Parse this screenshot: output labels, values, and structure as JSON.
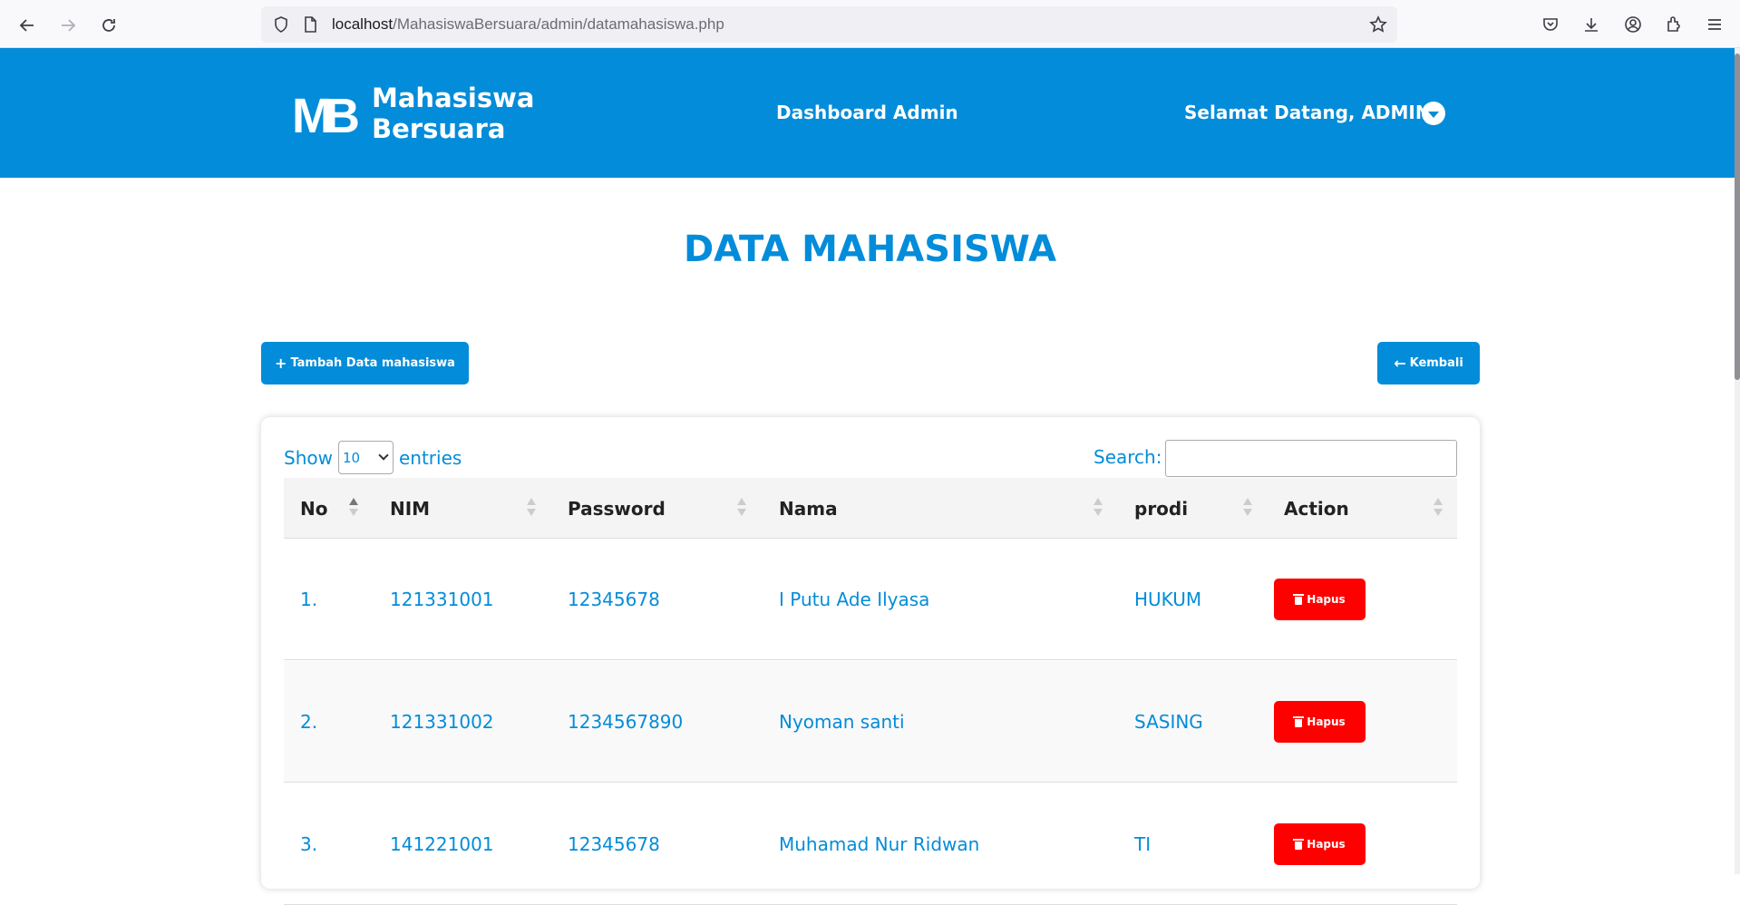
{
  "browser": {
    "url_host": "localhost",
    "url_path": "/MahasiswaBersuara/admin/datamahasiswa.php"
  },
  "header": {
    "logo_mark": "MB",
    "brand_line1": "Mahasiswa",
    "brand_line2": "Bersuara",
    "title": "Dashboard Admin",
    "greeting": "Selamat Datang, ADMIN"
  },
  "page": {
    "title": "DATA MAHASISWA",
    "add_button": "Tambah Data mahasiswa",
    "back_button": "Kembali"
  },
  "datatable": {
    "show_label": "Show",
    "entries_value": "10",
    "entries_label": "entries",
    "search_label": "Search:",
    "columns": [
      "No",
      "NIM",
      "Password",
      "Nama",
      "prodi",
      "Action"
    ],
    "delete_label": "Hapus",
    "rows": [
      {
        "no": "1.",
        "nim": "121331001",
        "password": "12345678",
        "nama": "I Putu Ade Ilyasa",
        "prodi": "HUKUM"
      },
      {
        "no": "2.",
        "nim": "121331002",
        "password": "1234567890",
        "nama": "Nyoman santi",
        "prodi": "SASING"
      },
      {
        "no": "3.",
        "nim": "141221001",
        "password": "12345678",
        "nama": "Muhamad Nur Ridwan",
        "prodi": "TI"
      }
    ]
  },
  "colors": {
    "primary": "#038cd9",
    "danger": "#ff0000"
  }
}
